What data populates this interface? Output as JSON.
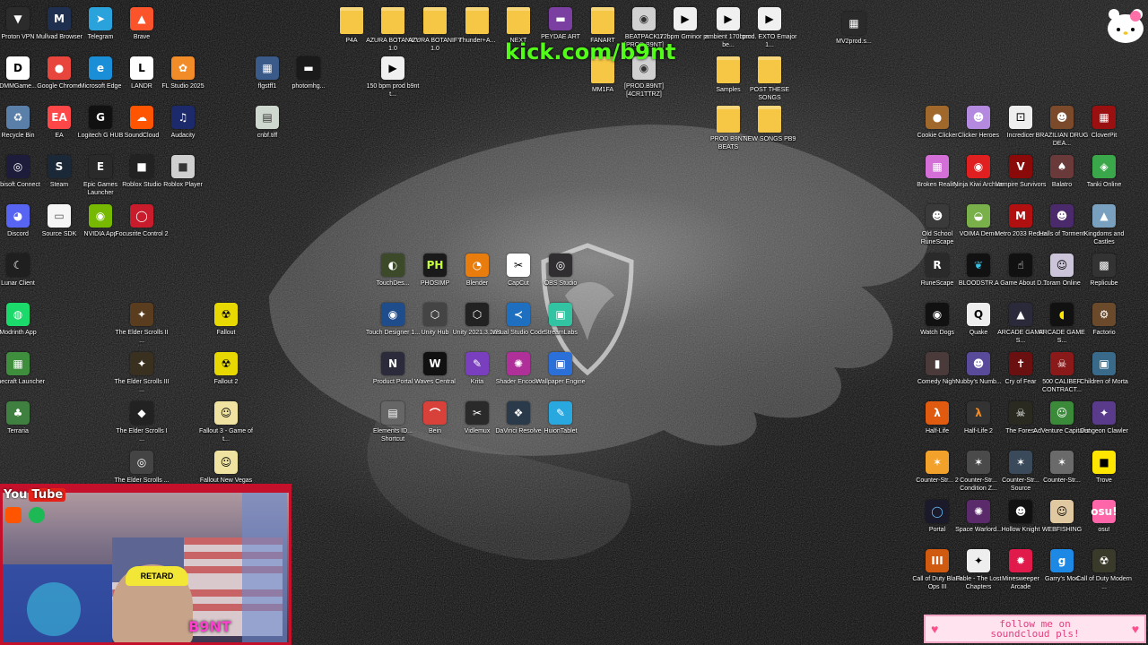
{
  "overlay": {
    "kick_url": "kick.com/b9nt",
    "youtube_label": "You",
    "youtube_badge": "Tube",
    "cap_text": "RETARD",
    "cam_logo": "B9NT",
    "soundcloud_banner": "follow me on\nsoundcloud pls!"
  },
  "colors": {
    "kick_green": "#53fc18",
    "webcam_frame": "#c4102a",
    "banner_pink": "#ffe4ef",
    "banner_text": "#e0407c"
  },
  "desktop_icons": [
    {
      "label": "Proton VPN",
      "icon": "vpn-icon",
      "color": "#2b2b2b",
      "glyph": "▼"
    },
    {
      "label": "Mullvad Browser",
      "icon": "mullvad-icon",
      "color": "#1f2f4f",
      "glyph": "M"
    },
    {
      "label": "Telegram",
      "icon": "telegram-icon",
      "color": "#2aa3dd",
      "glyph": "➤"
    },
    {
      "label": "Brave",
      "icon": "brave-icon",
      "color": "#fb542b",
      "glyph": "▲"
    },
    {
      "label": "DMMGame...",
      "icon": "dmm-icon",
      "color": "#ffffff",
      "glyph": "D",
      "fg": "#000"
    },
    {
      "label": "Google Chrome",
      "icon": "chrome-icon",
      "color": "#e8453c",
      "glyph": "●"
    },
    {
      "label": "Microsoft Edge",
      "icon": "edge-icon",
      "color": "#1a8fd8",
      "glyph": "e"
    },
    {
      "label": "LANDR",
      "icon": "landr-icon",
      "color": "#ffffff",
      "glyph": "L",
      "fg": "#000"
    },
    {
      "label": "FL Studio 2025",
      "icon": "flstudio-icon",
      "color": "#f28c28",
      "glyph": "✿"
    },
    {
      "label": "Recycle Bin",
      "icon": "recycle-bin-icon",
      "color": "#5a7fa8",
      "glyph": "♻"
    },
    {
      "label": "EA",
      "icon": "ea-icon",
      "color": "#ff4747",
      "glyph": "EA"
    },
    {
      "label": "Logitech G HUB",
      "icon": "logitech-icon",
      "color": "#111111",
      "glyph": "G"
    },
    {
      "label": "SoundCloud",
      "icon": "soundcloud-icon",
      "color": "#ff5500",
      "glyph": "☁"
    },
    {
      "label": "Audacity",
      "icon": "audacity-icon",
      "color": "#1c2a6b",
      "glyph": "♫"
    },
    {
      "label": "Ubisoft Connect",
      "icon": "ubisoft-icon",
      "color": "#1d1d3b",
      "glyph": "◎"
    },
    {
      "label": "Steam",
      "icon": "steam-icon",
      "color": "#1b2838",
      "glyph": "S"
    },
    {
      "label": "Epic Games Launcher",
      "icon": "epic-icon",
      "color": "#2a2a2a",
      "glyph": "E"
    },
    {
      "label": "Roblox Studio",
      "icon": "roblox-studio-icon",
      "color": "#222222",
      "glyph": "■"
    },
    {
      "label": "Roblox Player",
      "icon": "roblox-icon",
      "color": "#cfcfcf",
      "glyph": "■",
      "fg": "#333"
    },
    {
      "label": "Discord",
      "icon": "discord-icon",
      "color": "#5865f2",
      "glyph": "◕"
    },
    {
      "label": "Source SDK",
      "icon": "source-sdk-icon",
      "color": "#f5f5f5",
      "glyph": "▭",
      "fg": "#555"
    },
    {
      "label": "NVIDIA App",
      "icon": "nvidia-icon",
      "color": "#76b900",
      "glyph": "◉"
    },
    {
      "label": "Focusrite Control 2",
      "icon": "focusrite-icon",
      "color": "#c81c2d",
      "glyph": "◯"
    },
    {
      "label": "Lunar Client",
      "icon": "lunar-icon",
      "color": "#1f1f1f",
      "glyph": "☾"
    },
    {
      "label": "Modrinth App",
      "icon": "modrinth-icon",
      "color": "#1bd96a",
      "glyph": "◍"
    },
    {
      "label": "Minecraft Launcher",
      "icon": "minecraft-icon",
      "color": "#3e8e3e",
      "glyph": "▦"
    },
    {
      "label": "Terraria",
      "icon": "terraria-icon",
      "color": "#3f7f3f",
      "glyph": "♣"
    },
    {
      "label": "The Elder Scrolls II ...",
      "icon": "elder-scrolls-2-icon",
      "color": "#5a3d1f",
      "glyph": "✦"
    },
    {
      "label": "The Elder Scrolls III ...",
      "icon": "elder-scrolls-3-icon",
      "color": "#3a3020",
      "glyph": "✦"
    },
    {
      "label": "The Elder Scrolls I ...",
      "icon": "elder-scrolls-4-icon",
      "color": "#222222",
      "glyph": "◆"
    },
    {
      "label": "The Elder Scrolls ...",
      "icon": "elder-scrolls-5-icon",
      "color": "#444444",
      "glyph": "◎"
    },
    {
      "label": "Fallout",
      "icon": "fallout-icon",
      "color": "#e6d800",
      "glyph": "☢",
      "fg": "#000"
    },
    {
      "label": "Fallout 2",
      "icon": "fallout-2-icon",
      "color": "#e6d800",
      "glyph": "☢",
      "fg": "#000"
    },
    {
      "label": "Fallout 3 - Game of t...",
      "icon": "fallout-3-icon",
      "color": "#f0e2a0",
      "glyph": "☺",
      "fg": "#000"
    },
    {
      "label": "Fallout New Vegas",
      "icon": "fallout-nv-icon",
      "color": "#f0e2a0",
      "glyph": "☺",
      "fg": "#000"
    },
    {
      "label": "flgstff1",
      "icon": "image-file-icon",
      "color": "#3a5a8a",
      "glyph": "▦"
    },
    {
      "label": "photomhg...",
      "icon": "image-file-icon",
      "color": "#1a1a1a",
      "glyph": "▬"
    },
    {
      "label": "150 bpm prod b9nt t...",
      "icon": "audio-file-icon",
      "color": "#f0f0f0",
      "glyph": "▶",
      "fg": "#000"
    },
    {
      "label": "cnbf.tiff",
      "icon": "image-file-icon",
      "color": "#cfd8cf",
      "glyph": "▤",
      "fg": "#333"
    },
    {
      "label": "P4A",
      "icon": "folder-icon",
      "color": "#f6c744",
      "glyph": "",
      "folder": true
    },
    {
      "label": "AZURA BOTANIFY 1.0",
      "icon": "folder-icon",
      "color": "#f6c744",
      "glyph": "",
      "folder": true
    },
    {
      "label": "AZURA BOTANIFY 1.0",
      "icon": "folder-icon",
      "color": "#f6c744",
      "glyph": "",
      "folder": true
    },
    {
      "label": "Thunder+A...",
      "icon": "folder-icon",
      "color": "#f6c744",
      "glyph": "",
      "folder": true
    },
    {
      "label": "NEXT",
      "icon": "folder-icon",
      "color": "#f6c744",
      "glyph": "",
      "folder": true
    },
    {
      "label": "PEYDAE ART",
      "icon": "folder-icon",
      "color": "#7a3fa0",
      "glyph": "▬"
    },
    {
      "label": "FANART",
      "icon": "folder-icon",
      "color": "#f6c744",
      "glyph": "",
      "folder": true
    },
    {
      "label": "BEATPACK 1 [PROD.B9NT]",
      "icon": "disc-icon",
      "color": "#d0d0d0",
      "glyph": "◉",
      "fg": "#333"
    },
    {
      "label": "172bpm Gminor pr...",
      "icon": "audio-file-icon",
      "color": "#f0f0f0",
      "glyph": "▶",
      "fg": "#000"
    },
    {
      "label": "ambient 170bpm be...",
      "icon": "audio-file-icon",
      "color": "#f0f0f0",
      "glyph": "▶",
      "fg": "#000"
    },
    {
      "label": "prod. EXTO Emajor 1...",
      "icon": "audio-file-icon",
      "color": "#f0f0f0",
      "glyph": "▶",
      "fg": "#000"
    },
    {
      "label": "MV2prod.s...",
      "icon": "video-file-icon",
      "color": "#2a2a2a",
      "glyph": "▦"
    },
    {
      "label": "MM1FA",
      "icon": "folder-icon",
      "color": "#f6c744",
      "glyph": "",
      "folder": true
    },
    {
      "label": "[PROD.B9NT] [4CR1TTRZ]",
      "icon": "disc-icon",
      "color": "#d0d0d0",
      "glyph": "◉",
      "fg": "#333"
    },
    {
      "label": "Samples",
      "icon": "folder-icon",
      "color": "#f6c744",
      "glyph": "",
      "folder": true
    },
    {
      "label": "POST THESE SONGS",
      "icon": "folder-icon",
      "color": "#f6c744",
      "glyph": "",
      "folder": true
    },
    {
      "label": "PROD B9NT BEATS",
      "icon": "folder-icon",
      "color": "#f6c744",
      "glyph": "",
      "folder": true
    },
    {
      "label": "NEW SONGS PB9",
      "icon": "folder-icon",
      "color": "#f6c744",
      "glyph": "",
      "folder": true
    },
    {
      "label": "TouchDes...",
      "icon": "touchdesigner-icon",
      "color": "#3c4a2a",
      "glyph": "◐"
    },
    {
      "label": "PHOSIMP",
      "icon": "photoshop-icon",
      "color": "#1a1a1a",
      "glyph": "PH",
      "fg": "#c6ff3a"
    },
    {
      "label": "Blender",
      "icon": "blender-icon",
      "color": "#e87d0d",
      "glyph": "◔"
    },
    {
      "label": "CapCut",
      "icon": "capcut-icon",
      "color": "#ffffff",
      "glyph": "✂",
      "fg": "#000"
    },
    {
      "label": "OBS Studio",
      "icon": "obs-icon",
      "color": "#302e31",
      "glyph": "◎"
    },
    {
      "label": "Touch Designer 1...",
      "icon": "touchdesigner-2-icon",
      "color": "#1f4c8a",
      "glyph": "◉"
    },
    {
      "label": "Unity Hub",
      "icon": "unity-hub-icon",
      "color": "#444444",
      "glyph": "⬡"
    },
    {
      "label": "Unity 2021.3.16f1",
      "icon": "unity-icon",
      "color": "#222222",
      "glyph": "⬡"
    },
    {
      "label": "Visual Studio Code",
      "icon": "vscode-icon",
      "color": "#1e6fbf",
      "glyph": "≺"
    },
    {
      "label": "StreamLabs",
      "icon": "streamlabs-icon",
      "color": "#31c3a2",
      "glyph": "▣"
    },
    {
      "label": "Product Portal",
      "icon": "product-portal-icon",
      "color": "#2b2b3b",
      "glyph": "N"
    },
    {
      "label": "Waves Central",
      "icon": "waves-icon",
      "color": "#111111",
      "glyph": "W"
    },
    {
      "label": "Krita",
      "icon": "krita-icon",
      "color": "#7a3fbf",
      "glyph": "✎"
    },
    {
      "label": "Shader Encoder",
      "icon": "shader-icon",
      "color": "#b0309a",
      "glyph": "✺"
    },
    {
      "label": "Wallpaper Engine",
      "icon": "wallpaper-engine-icon",
      "color": "#2b6fd9",
      "glyph": "▣"
    },
    {
      "label": "Elements ID... Shortcut",
      "icon": "elements-icon",
      "color": "#666666",
      "glyph": "▤"
    },
    {
      "label": "Bein",
      "icon": "bein-icon",
      "color": "#d8403a",
      "glyph": "⌒"
    },
    {
      "label": "Vidlemux",
      "icon": "vidlemux-icon",
      "color": "#2a2a2a",
      "glyph": "✂"
    },
    {
      "label": "DaVinci Resolve",
      "icon": "davinci-icon",
      "color": "#2a3a4a",
      "glyph": "❖"
    },
    {
      "label": "HuionTablet",
      "icon": "huion-icon",
      "color": "#29a8e0",
      "glyph": "✎"
    },
    {
      "label": "Cookie Clicker",
      "icon": "cookie-clicker-icon",
      "color": "#a0682a",
      "glyph": "●"
    },
    {
      "label": "Clicker Heroes",
      "icon": "clicker-heroes-icon",
      "color": "#b38adf",
      "glyph": "☻"
    },
    {
      "label": "Incredicer",
      "icon": "incredicer-icon",
      "color": "#eeeeee",
      "glyph": "⚀",
      "fg": "#000"
    },
    {
      "label": "BRAZILIAN DRUG DEA...",
      "icon": "brazilian-drug-dealer-icon",
      "color": "#7a4a2a",
      "glyph": "☻"
    },
    {
      "label": "CloverPit",
      "icon": "cloverpit-icon",
      "color": "#9a1010",
      "glyph": "▦"
    },
    {
      "label": "Broken Reality",
      "icon": "broken-reality-icon",
      "color": "#d46fd8",
      "glyph": "▦"
    },
    {
      "label": "Ninja Kiwi Archive",
      "icon": "ninja-kiwi-icon",
      "color": "#e02020",
      "glyph": "◉"
    },
    {
      "label": "Vampire Survivors",
      "icon": "vampire-survivors-icon",
      "color": "#8a0a0a",
      "glyph": "V"
    },
    {
      "label": "Balatro",
      "icon": "balatro-icon",
      "color": "#6a3a3a",
      "glyph": "♠"
    },
    {
      "label": "Tanki Online",
      "icon": "tanki-icon",
      "color": "#3aa84a",
      "glyph": "◈"
    },
    {
      "label": "Old School RuneScape",
      "icon": "osrs-icon",
      "color": "#3a3a3a",
      "glyph": "☻"
    },
    {
      "label": "VOIMA Demo",
      "icon": "voima-icon",
      "color": "#7ab04a",
      "glyph": "◒"
    },
    {
      "label": "Metro 2033 Redux",
      "icon": "metro-icon",
      "color": "#b01010",
      "glyph": "M"
    },
    {
      "label": "Halls of Torment",
      "icon": "halls-icon",
      "color": "#4a2a6a",
      "glyph": "☻"
    },
    {
      "label": "Kingdoms and Castles",
      "icon": "kingdoms-icon",
      "color": "#7aa0c0",
      "glyph": "▲"
    },
    {
      "label": "RuneScape",
      "icon": "runescape-icon",
      "color": "#2a2a2a",
      "glyph": "R"
    },
    {
      "label": "BLOODSTR...",
      "icon": "bloodstrike-icon",
      "color": "#111111",
      "glyph": "❦",
      "fg": "#35c3e6"
    },
    {
      "label": "A Game About D...",
      "icon": "a-game-about-icon",
      "color": "#111111",
      "glyph": "☝"
    },
    {
      "label": "Toram Online",
      "icon": "toram-icon",
      "color": "#ccc4d8",
      "glyph": "☺",
      "fg": "#000"
    },
    {
      "label": "Replicube",
      "icon": "replicube-icon",
      "color": "#333333",
      "glyph": "▩"
    },
    {
      "label": "Watch Dogs",
      "icon": "watch-dogs-icon",
      "color": "#111111",
      "glyph": "◉"
    },
    {
      "label": "Quake",
      "icon": "quake-icon",
      "color": "#eeeeee",
      "glyph": "Q",
      "fg": "#000"
    },
    {
      "label": "ARCADE GAME S...",
      "icon": "arcade-icon",
      "color": "#2a2a3a",
      "glyph": "▲"
    },
    {
      "label": "ARCADE GAME S...",
      "icon": "pacman-icon",
      "color": "#111111",
      "glyph": "◖",
      "fg": "#ffe600"
    },
    {
      "label": "Factorio",
      "icon": "factorio-icon",
      "color": "#6a4a2a",
      "glyph": "⚙"
    },
    {
      "label": "Comedy Night",
      "icon": "comedy-night-icon",
      "color": "#4a3a3a",
      "glyph": "▮"
    },
    {
      "label": "Nubby's Numb...",
      "icon": "nubby-icon",
      "color": "#5a4a9a",
      "glyph": "☻"
    },
    {
      "label": "Cry of Fear",
      "icon": "cry-of-fear-icon",
      "color": "#6a1010",
      "glyph": "✝"
    },
    {
      "label": "500 CALIBER CONTRACT...",
      "icon": "caliber-icon",
      "color": "#8a1a1a",
      "glyph": "☠"
    },
    {
      "label": "Children of Morta",
      "icon": "children-morta-icon",
      "color": "#3a6a8a",
      "glyph": "▣"
    },
    {
      "label": "Half-Life",
      "icon": "half-life-icon",
      "color": "#e05a10",
      "glyph": "λ"
    },
    {
      "label": "Half-Life 2",
      "icon": "half-life-2-icon",
      "color": "#333333",
      "glyph": "λ",
      "fg": "#f28c28"
    },
    {
      "label": "The Forest",
      "icon": "the-forest-icon",
      "color": "#2a2a20",
      "glyph": "☠"
    },
    {
      "label": "AdVenture Capitalist",
      "icon": "adventure-capitalist-icon",
      "color": "#3a8a3a",
      "glyph": "☺"
    },
    {
      "label": "Dungeon Clawler",
      "icon": "dungeon-clawler-icon",
      "color": "#5a3a8a",
      "glyph": "✦"
    },
    {
      "label": "Counter-Str... 2",
      "icon": "cs2-icon",
      "color": "#f2a12a",
      "glyph": "✶"
    },
    {
      "label": "Counter-Str... Condition Z...",
      "icon": "cscz-icon",
      "color": "#4a4a4a",
      "glyph": "✶"
    },
    {
      "label": "Counter-Str... Source",
      "icon": "css-icon",
      "color": "#3a4a5a",
      "glyph": "✶"
    },
    {
      "label": "Counter-Str...",
      "icon": "cs-icon",
      "color": "#6a6a6a",
      "glyph": "✶"
    },
    {
      "label": "Trove",
      "icon": "trove-icon",
      "color": "#ffe600",
      "glyph": "■",
      "fg": "#000"
    },
    {
      "label": "Portal",
      "icon": "portal-icon",
      "color": "#1a1a2a",
      "glyph": "◯",
      "fg": "#6ac0ff"
    },
    {
      "label": "Space Warlord...",
      "icon": "space-warlord-icon",
      "color": "#5a2a6a",
      "glyph": "✺"
    },
    {
      "label": "Hollow Knight",
      "icon": "hollow-knight-icon",
      "color": "#111111",
      "glyph": "☻"
    },
    {
      "label": "WEBFISHING",
      "icon": "webfishing-icon",
      "color": "#e0c8a0",
      "glyph": "☺",
      "fg": "#000"
    },
    {
      "label": "osu!",
      "icon": "osu-icon",
      "color": "#ff66aa",
      "glyph": "osu!"
    },
    {
      "label": "Call of Duty Black Ops III",
      "icon": "cod-bo3-icon",
      "color": "#d05a10",
      "glyph": "III"
    },
    {
      "label": "Fable - The Lost Chapters",
      "icon": "fable-icon",
      "color": "#eeeeee",
      "glyph": "✦",
      "fg": "#000"
    },
    {
      "label": "Minesweeper Arcade",
      "icon": "minesweeper-icon",
      "color": "#e01a4a",
      "glyph": "✹"
    },
    {
      "label": "Garry's Mod",
      "icon": "garrys-mod-icon",
      "color": "#1e88e5",
      "glyph": "g"
    },
    {
      "label": "Call of Duty Modern ...",
      "icon": "cod-mw-icon",
      "color": "#3a3a2a",
      "glyph": "☢"
    }
  ]
}
